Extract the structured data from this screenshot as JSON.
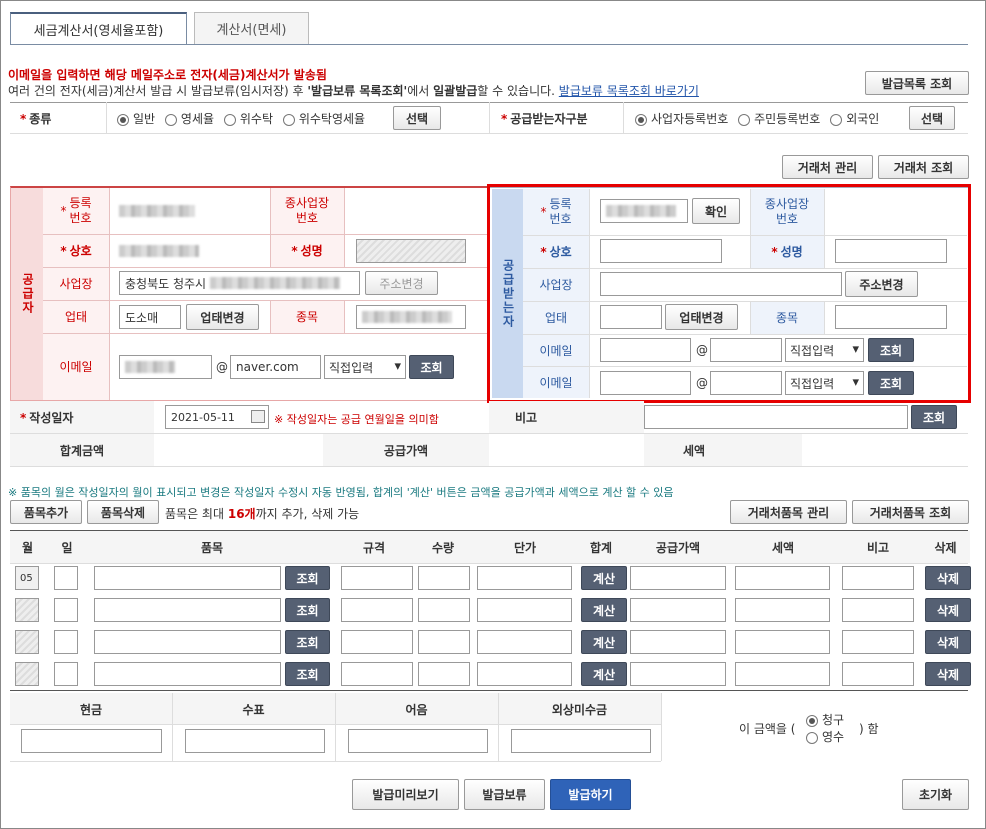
{
  "tabs": [
    "세금계산서(영세율포함)",
    "계산서(면세)"
  ],
  "notice": {
    "line1": "이메일을 입력하면 해당 메일주소로 전자(세금)계산서가 발송됨",
    "line2a": "여러 건의 전자(세금)계산서 발급 시 발급보류(임시저장) 후 ",
    "line2b": "'발급보류 목록조회'",
    "line2c": "에서 ",
    "line2d": "일괄발급",
    "line2e": "할 수 있습니다. ",
    "link": "발급보류 목록조회 바로가기"
  },
  "btn_issue_list": "발급목록 조회",
  "type_row": {
    "label": "종류",
    "options": [
      "일반",
      "영세율",
      "위수탁",
      "위수탁영세율"
    ],
    "selected": 0,
    "select_btn": "선택",
    "recv_label": "공급받는자구분",
    "recv_options": [
      "사업자등록번호",
      "주민등록번호",
      "외국인"
    ],
    "recv_selected": 0,
    "recv_btn": "선택"
  },
  "partner_btns": [
    "거래처 관리",
    "거래처 조회"
  ],
  "supplier": {
    "side": "공급자",
    "reg_no": "등록\n번호",
    "branch": "종사업장\n번호",
    "name": "상호",
    "ceo": "성명",
    "addr": "사업장",
    "addr_value": "충청북도 청주시",
    "addr_btn": "주소변경",
    "biz_type": "업태",
    "biz_type_value": "도소매",
    "biz_btn": "업태변경",
    "item": "종목",
    "email": "이메일",
    "email_domain": "naver.com",
    "email_select": "직접입력",
    "lookup": "조회"
  },
  "receiver": {
    "side": "공급받는자",
    "reg_no": "등록\n번호",
    "confirm": "확인",
    "branch": "종사업장\n번호",
    "name": "상호",
    "ceo": "성명",
    "addr": "사업장",
    "addr_btn": "주소변경",
    "biz_type": "업태",
    "biz_btn": "업태변경",
    "item": "종목",
    "email": "이메일",
    "at": "@",
    "email_select": "직접입력",
    "lookup": "조회"
  },
  "date_row": {
    "label": "작성일자",
    "value": "2021-05-11",
    "note": "※ 작성일자는 공급 연월일을 의미함",
    "remark": "비고",
    "lookup": "조회"
  },
  "sum_row": {
    "total": "합계금액",
    "supply": "공급가액",
    "tax": "세액"
  },
  "items_note": "※ 품목의 월은 작성일자의 월이 표시되고 변경은 작성일자 수정시 자동 반영됨, 합계의 '계산' 버튼은 금액을 공급가액과 세액으로 계산 할 수 있음",
  "items_toolbar": {
    "add": "품목추가",
    "del": "품목삭제",
    "info_a": "품목은 최대 ",
    "info_b": "16개",
    "info_c": "까지 추가, 삭제 가능",
    "manage": "거래처품목 관리",
    "lookup": "거래처품목 조회"
  },
  "items_headers": [
    "월",
    "일",
    "품목",
    "규격",
    "수량",
    "단가",
    "합계",
    "공급가액",
    "세액",
    "비고",
    "삭제"
  ],
  "items_rows": [
    {
      "month": "05"
    },
    {
      "month": ""
    },
    {
      "month": ""
    },
    {
      "month": ""
    }
  ],
  "row_btns": {
    "lookup": "조회",
    "calc": "계산",
    "del": "삭제"
  },
  "payment": {
    "headers": [
      "현금",
      "수표",
      "어음",
      "외상미수금"
    ],
    "text_a": "이 금액을 (",
    "opt1": "청구",
    "opt2": "영수",
    "text_b": ") 함"
  },
  "bottom": {
    "preview": "발급미리보기",
    "hold": "발급보류",
    "issue": "발급하기",
    "reset": "초기화"
  },
  "colors": {
    "highlight": "#e60000",
    "receiver_side": "#c9d9f0",
    "supplier_side": "#f7dcdc",
    "dark_btn": "#556073",
    "issue_btn": "#2f63b8"
  }
}
